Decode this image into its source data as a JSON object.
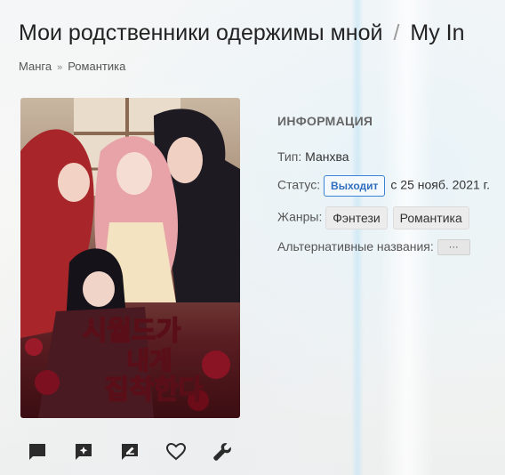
{
  "header": {
    "title": "Мои родственники одержимы мной",
    "separator": "/",
    "alt_title": "My In"
  },
  "breadcrumb": {
    "items": [
      "Манга",
      "Романтика"
    ],
    "separator": "»"
  },
  "info": {
    "heading": "ИНФОРМАЦИЯ",
    "type_label": "Тип:",
    "type_value": "Манхва",
    "status_label": "Статус:",
    "status_badge": "Выходит",
    "status_since": "с 25 нояб. 2021 г.",
    "genres_label": "Жанры:",
    "genres": [
      "Фэнтези",
      "Романтика"
    ],
    "alt_names_label": "Альтернативные названия:",
    "alt_names_button": "···"
  },
  "cover": {
    "title_text": "시월드가 내게 집착한다"
  },
  "actions": [
    {
      "name": "comments-icon"
    },
    {
      "name": "add-review-icon"
    },
    {
      "name": "edit-icon"
    },
    {
      "name": "favorite-heart-icon"
    },
    {
      "name": "wrench-icon"
    }
  ],
  "colors": {
    "status_badge": "#2f6fbf",
    "icon": "#2b2b2b"
  }
}
